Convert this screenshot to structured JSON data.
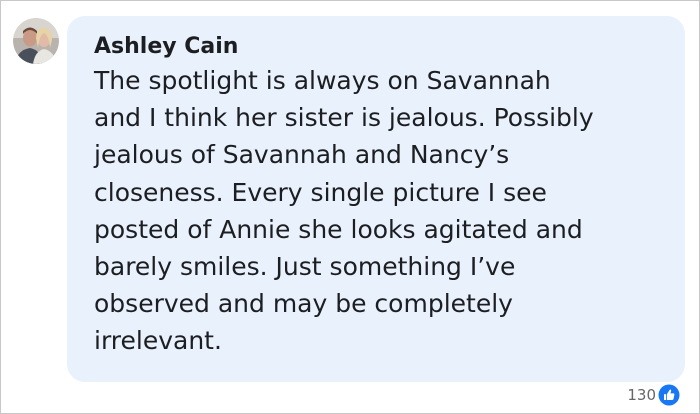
{
  "comment": {
    "author": "Ashley Cain",
    "body_lines": [
      "The spotlight is always on Savannah",
      "and I think her sister is jealous. Possibly",
      "jealous of Savannah and Nancy’s",
      "closeness. Every single picture I see",
      "posted of Annie she looks agitated and",
      "barely smiles. Just something I’ve",
      "observed and may be completely",
      "irrelevant."
    ],
    "reaction_count": "130",
    "reaction_icon": "like-icon"
  },
  "colors": {
    "bubble_bg": "#e9f1fc",
    "text": "#1c1e21",
    "meta_text": "#65676b",
    "like_blue": "#1877f2"
  }
}
